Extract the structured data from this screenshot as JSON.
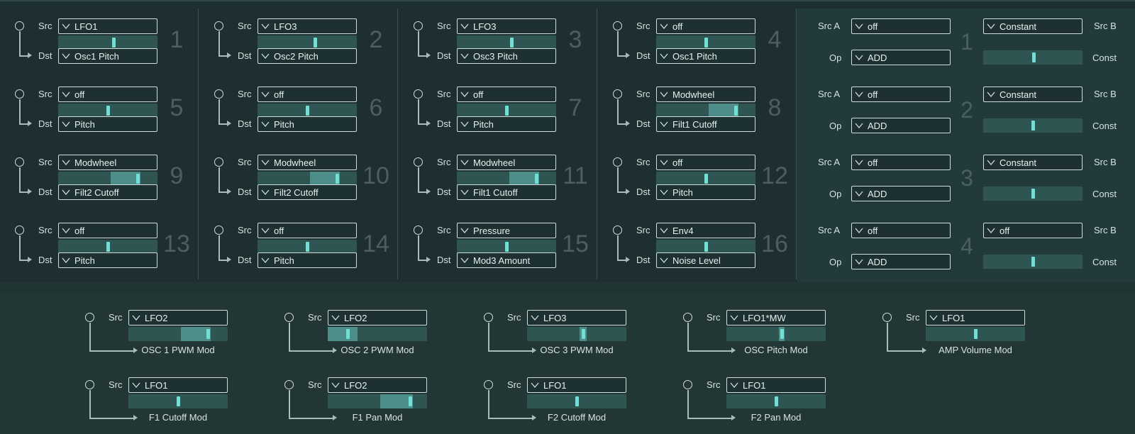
{
  "labels": {
    "src": "Src",
    "dst": "Dst",
    "src_a": "Src A",
    "src_b": "Src B",
    "op": "Op",
    "const": "Const"
  },
  "matrix": [
    {
      "num": "1",
      "src": "LFO1",
      "dst": "Osc1 Pitch",
      "amount": 0.56,
      "width": 0
    },
    {
      "num": "2",
      "src": "LFO3",
      "dst": "Osc2 Pitch",
      "amount": 0.58,
      "width": 0
    },
    {
      "num": "3",
      "src": "LFO3",
      "dst": "Osc3 Pitch",
      "amount": 0.55,
      "width": 0
    },
    {
      "num": "4",
      "src": "off",
      "dst": "Osc1 Pitch",
      "amount": 0.5,
      "width": 0
    },
    {
      "num": "5",
      "src": "off",
      "dst": "Pitch",
      "amount": 0.5,
      "width": 0
    },
    {
      "num": "6",
      "src": "off",
      "dst": "Pitch",
      "amount": 0.5,
      "width": 0
    },
    {
      "num": "7",
      "src": "off",
      "dst": "Pitch",
      "amount": 0.5,
      "width": 0
    },
    {
      "num": "8",
      "src": "Modwheel",
      "dst": "Filt1 Cutoff",
      "amount": 0.8,
      "width": 0.3
    },
    {
      "num": "9",
      "src": "Modwheel",
      "dst": "Filt2 Cutoff",
      "amount": 0.8,
      "width": 0.3
    },
    {
      "num": "10",
      "src": "Modwheel",
      "dst": "Filt2 Cutoff",
      "amount": 0.8,
      "width": 0.3
    },
    {
      "num": "11",
      "src": "Modwheel",
      "dst": "Filt1 Cutoff",
      "amount": 0.8,
      "width": 0.3
    },
    {
      "num": "12",
      "src": "off",
      "dst": "Pitch",
      "amount": 0.5,
      "width": 0
    },
    {
      "num": "13",
      "src": "off",
      "dst": "Pitch",
      "amount": 0.5,
      "width": 0
    },
    {
      "num": "14",
      "src": "off",
      "dst": "Pitch",
      "amount": 0.5,
      "width": 0
    },
    {
      "num": "15",
      "src": "Pressure",
      "dst": "Mod3 Amount",
      "amount": 0.5,
      "width": 0
    },
    {
      "num": "16",
      "src": "Env4",
      "dst": "Noise Level",
      "amount": 0.5,
      "width": 0
    }
  ],
  "operators": [
    {
      "num": "1",
      "src_a": "off",
      "op": "ADD",
      "src_b": "Constant",
      "const": 0.51
    },
    {
      "num": "2",
      "src_a": "off",
      "op": "ADD",
      "src_b": "Constant",
      "const": 0.5
    },
    {
      "num": "3",
      "src_a": "off",
      "op": "ADD",
      "src_b": "Constant",
      "const": 0.5
    },
    {
      "num": "4",
      "src_a": "off",
      "op": "ADD",
      "src_b": "off",
      "const": 0.5
    }
  ],
  "fixed": [
    {
      "src": "LFO2",
      "dest": "OSC 1 PWM Mod",
      "amount": 0.8,
      "width": 0.3
    },
    {
      "src": "LFO2",
      "dest": "OSC 2 PWM Mod",
      "amount": 0.2,
      "width": 0.3
    },
    {
      "src": "LFO3",
      "dest": "OSC 3 PWM Mod",
      "amount": 0.57,
      "width": 0.07
    },
    {
      "src": "LFO1*MW",
      "dest": "OSC Pitch Mod",
      "amount": 0.56,
      "width": 0.06
    },
    {
      "src": "LFO1",
      "dest": "AMP Volume Mod",
      "amount": 0.5,
      "width": 0
    },
    {
      "src": "LFO1",
      "dest": "F1 Cutoff Mod",
      "amount": 0.5,
      "width": 0
    },
    {
      "src": "LFO2",
      "dest": "F1 Pan Mod",
      "amount": 0.83,
      "width": 0.33
    },
    {
      "src": "LFO1",
      "dest": "F2 Cutoff Mod",
      "amount": 0.5,
      "width": 0
    },
    {
      "src": "LFO1",
      "dest": "F2 Pan Mod",
      "amount": 0.5,
      "width": 0
    }
  ],
  "colors": {
    "accent": "#6ee0d6",
    "slider_track": "#2f5552",
    "slider_fill": "#4e8e8a",
    "background": "#1d2f31"
  }
}
